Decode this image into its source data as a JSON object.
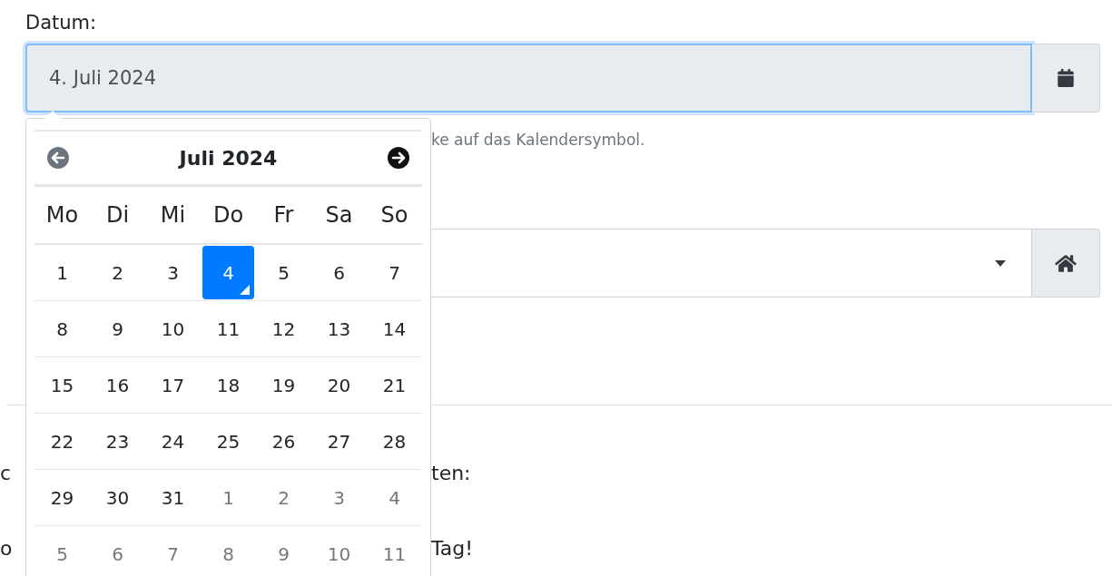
{
  "date_field": {
    "label": "Datum:",
    "value": "4. Juli 2024"
  },
  "help_text": "ke auf das Kalendersymbol.",
  "datepicker": {
    "month": "Juli 2024",
    "weekdays": [
      "Mo",
      "Di",
      "Mi",
      "Do",
      "Fr",
      "Sa",
      "So"
    ],
    "weeks": [
      [
        {
          "day": "1",
          "outside": false,
          "selected": false,
          "today": false
        },
        {
          "day": "2",
          "outside": false,
          "selected": false,
          "today": false
        },
        {
          "day": "3",
          "outside": false,
          "selected": false,
          "today": false
        },
        {
          "day": "4",
          "outside": false,
          "selected": true,
          "today": true
        },
        {
          "day": "5",
          "outside": false,
          "selected": false,
          "today": false
        },
        {
          "day": "6",
          "outside": false,
          "selected": false,
          "today": false
        },
        {
          "day": "7",
          "outside": false,
          "selected": false,
          "today": false
        }
      ],
      [
        {
          "day": "8",
          "outside": false,
          "selected": false,
          "today": false
        },
        {
          "day": "9",
          "outside": false,
          "selected": false,
          "today": false
        },
        {
          "day": "10",
          "outside": false,
          "selected": false,
          "today": false
        },
        {
          "day": "11",
          "outside": false,
          "selected": false,
          "today": false
        },
        {
          "day": "12",
          "outside": false,
          "selected": false,
          "today": false
        },
        {
          "day": "13",
          "outside": false,
          "selected": false,
          "today": false
        },
        {
          "day": "14",
          "outside": false,
          "selected": false,
          "today": false
        }
      ],
      [
        {
          "day": "15",
          "outside": false,
          "selected": false,
          "today": false
        },
        {
          "day": "16",
          "outside": false,
          "selected": false,
          "today": false
        },
        {
          "day": "17",
          "outside": false,
          "selected": false,
          "today": false
        },
        {
          "day": "18",
          "outside": false,
          "selected": false,
          "today": false
        },
        {
          "day": "19",
          "outside": false,
          "selected": false,
          "today": false
        },
        {
          "day": "20",
          "outside": false,
          "selected": false,
          "today": false
        },
        {
          "day": "21",
          "outside": false,
          "selected": false,
          "today": false
        }
      ],
      [
        {
          "day": "22",
          "outside": false,
          "selected": false,
          "today": false
        },
        {
          "day": "23",
          "outside": false,
          "selected": false,
          "today": false
        },
        {
          "day": "24",
          "outside": false,
          "selected": false,
          "today": false
        },
        {
          "day": "25",
          "outside": false,
          "selected": false,
          "today": false
        },
        {
          "day": "26",
          "outside": false,
          "selected": false,
          "today": false
        },
        {
          "day": "27",
          "outside": false,
          "selected": false,
          "today": false
        },
        {
          "day": "28",
          "outside": false,
          "selected": false,
          "today": false
        }
      ],
      [
        {
          "day": "29",
          "outside": false,
          "selected": false,
          "today": false
        },
        {
          "day": "30",
          "outside": false,
          "selected": false,
          "today": false
        },
        {
          "day": "31",
          "outside": false,
          "selected": false,
          "today": false
        },
        {
          "day": "1",
          "outside": true,
          "selected": false,
          "today": false
        },
        {
          "day": "2",
          "outside": true,
          "selected": false,
          "today": false
        },
        {
          "day": "3",
          "outside": true,
          "selected": false,
          "today": false
        },
        {
          "day": "4",
          "outside": true,
          "selected": false,
          "today": false
        }
      ],
      [
        {
          "day": "5",
          "outside": true,
          "selected": false,
          "today": false
        },
        {
          "day": "6",
          "outside": true,
          "selected": false,
          "today": false
        },
        {
          "day": "7",
          "outside": true,
          "selected": false,
          "today": false
        },
        {
          "day": "8",
          "outside": true,
          "selected": false,
          "today": false
        },
        {
          "day": "9",
          "outside": true,
          "selected": false,
          "today": false
        },
        {
          "day": "10",
          "outside": true,
          "selected": false,
          "today": false
        },
        {
          "day": "11",
          "outside": true,
          "selected": false,
          "today": false
        }
      ]
    ]
  },
  "fragments": [
    {
      "left": "c",
      "right": "ten:"
    },
    {
      "left": "o",
      "right": "Tag!"
    }
  ]
}
